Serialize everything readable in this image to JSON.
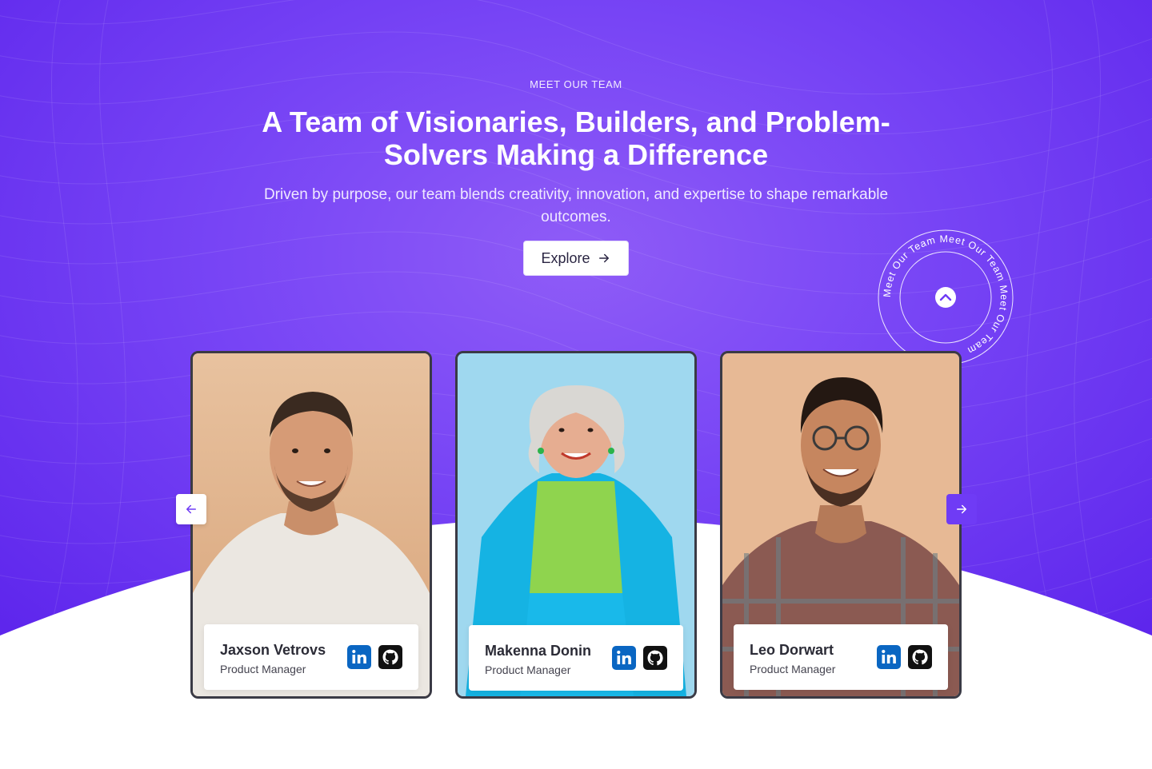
{
  "hero": {
    "eyebrow": "MEET OUR TEAM",
    "headline": "A Team of Visionaries, Builders, and Problem-Solvers Making a Difference",
    "subtext": "Driven by purpose, our team blends creativity, innovation, and expertise to shape remarkable outcomes.",
    "explore_label": "Explore",
    "explore_icon": "arrow-right-icon"
  },
  "badge": {
    "ring_text": "Meet Our Team Meet Our Team Meet Our Team ",
    "center_icon": "chevron-up-icon"
  },
  "carousel": {
    "prev_icon": "arrow-left-icon",
    "next_icon": "arrow-right-icon",
    "members": [
      {
        "name": "Jaxson Vetrovs",
        "role": "Product Manager",
        "social": [
          "linkedin-icon",
          "github-icon"
        ]
      },
      {
        "name": "Makenna Donin",
        "role": "Product Manager",
        "social": [
          "linkedin-icon",
          "github-icon"
        ]
      },
      {
        "name": "Leo Dorwart",
        "role": "Product Manager",
        "social": [
          "linkedin-icon",
          "github-icon"
        ]
      }
    ]
  },
  "colors": {
    "hero_gradient_start": "#8f5cf7",
    "hero_gradient_end": "#5d25ec",
    "accent": "#6f3bf5",
    "linkedin": "#0a66c2",
    "github": "#111111"
  }
}
